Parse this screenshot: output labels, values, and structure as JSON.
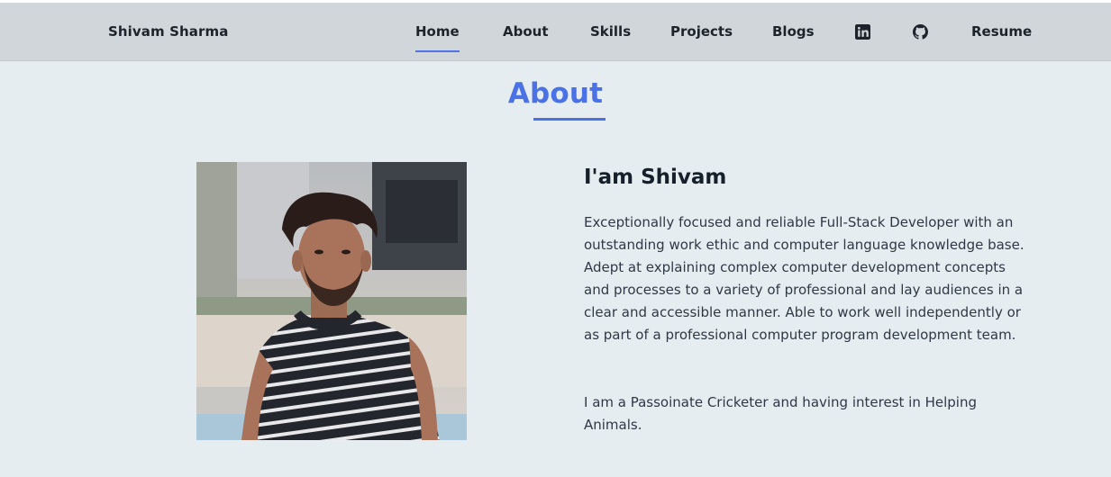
{
  "nav": {
    "brand": "Shivam Sharma",
    "links": [
      {
        "label": "Home",
        "active": true
      },
      {
        "label": "About"
      },
      {
        "label": "Skills"
      },
      {
        "label": "Projects"
      },
      {
        "label": "Blogs"
      }
    ],
    "icons": [
      "linkedin-icon",
      "github-icon"
    ],
    "resume_label": "Resume"
  },
  "about": {
    "section_title": "About",
    "heading": "I'am Shivam",
    "paragraph1": "Exceptionally focused and reliable Full-Stack Developer with an outstanding work ethic and computer language knowledge base. Adept at explaining complex computer development concepts and processes to a variety of professional and lay audiences in a clear and accessible manner. Able to work well independently or as part of a professional computer program development team.",
    "paragraph2": "I am a Passoinate Cricketer and having interest in Helping Animals."
  },
  "colors": {
    "accent": "#4a71e6",
    "navbar_bg": "#d1d6da",
    "page_bg": "#e6edf1"
  }
}
